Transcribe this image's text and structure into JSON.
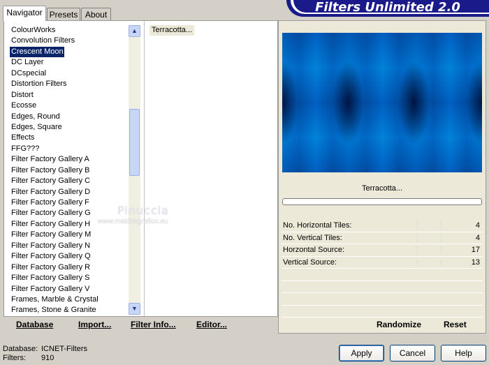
{
  "tabs": [
    "Navigator",
    "Presets",
    "About"
  ],
  "banner_title": "Filters Unlimited 2.0",
  "categories": [
    "ColourWorks",
    "Convolution Filters",
    "Crescent Moon",
    "DC Layer",
    "DCspecial",
    "Distortion Filters",
    "Distort",
    "Ecosse",
    "Edges, Round",
    "Edges, Square",
    "Effects",
    "FFG???",
    "Filter Factory Gallery A",
    "Filter Factory Gallery B",
    "Filter Factory Gallery C",
    "Filter Factory Gallery D",
    "Filter Factory Gallery F",
    "Filter Factory Gallery G",
    "Filter Factory Gallery H",
    "Filter Factory Gallery M",
    "Filter Factory Gallery N",
    "Filter Factory Gallery Q",
    "Filter Factory Gallery R",
    "Filter Factory Gallery S",
    "Filter Factory Gallery V",
    "Frames, Marble & Crystal",
    "Frames, Stone & Granite"
  ],
  "selected_category": "Crescent Moon",
  "filters": [
    "Terracotta..."
  ],
  "watermark": {
    "name": "Pinuccia",
    "url": "www.maidiregrafico.eu"
  },
  "left_buttons": {
    "database": "Database",
    "import": "Import...",
    "filter_info": "Filter Info...",
    "editor": "Editor..."
  },
  "preview_filter_name": "Terracotta...",
  "params": [
    {
      "label": "No. Horizontal Tiles:",
      "value": "4"
    },
    {
      "label": "No. Vertical Tiles:",
      "value": "4"
    },
    {
      "label": "Horzontal Source:",
      "value": "17"
    },
    {
      "label": "Vertical Source:",
      "value": "13"
    }
  ],
  "right_buttons": {
    "randomize": "Randomize",
    "reset": "Reset"
  },
  "status": {
    "database_label": "Database:",
    "database_value": "ICNET-Filters",
    "filters_label": "Filters:",
    "filters_value": "910"
  },
  "dialog_buttons": {
    "apply": "Apply",
    "cancel": "Cancel",
    "help": "Help"
  }
}
